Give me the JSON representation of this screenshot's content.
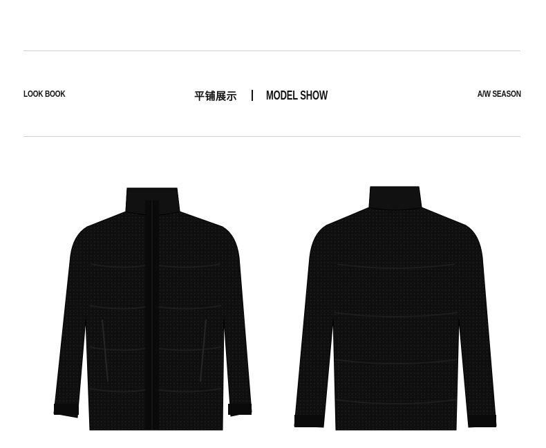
{
  "header": {
    "left_label": "LOOK BOOK",
    "center_cn": "平铺展示",
    "center_en": "MODEL SHOW",
    "right_label": "A/W SEASON"
  },
  "products": [
    {
      "view": "front",
      "image": "black-down-jacket-front"
    },
    {
      "view": "back",
      "image": "black-down-jacket-back"
    }
  ],
  "colors": {
    "jacket": "#0d0d0d",
    "jacket_highlight": "#1c1c1c",
    "rule": "#cfcfcf"
  }
}
